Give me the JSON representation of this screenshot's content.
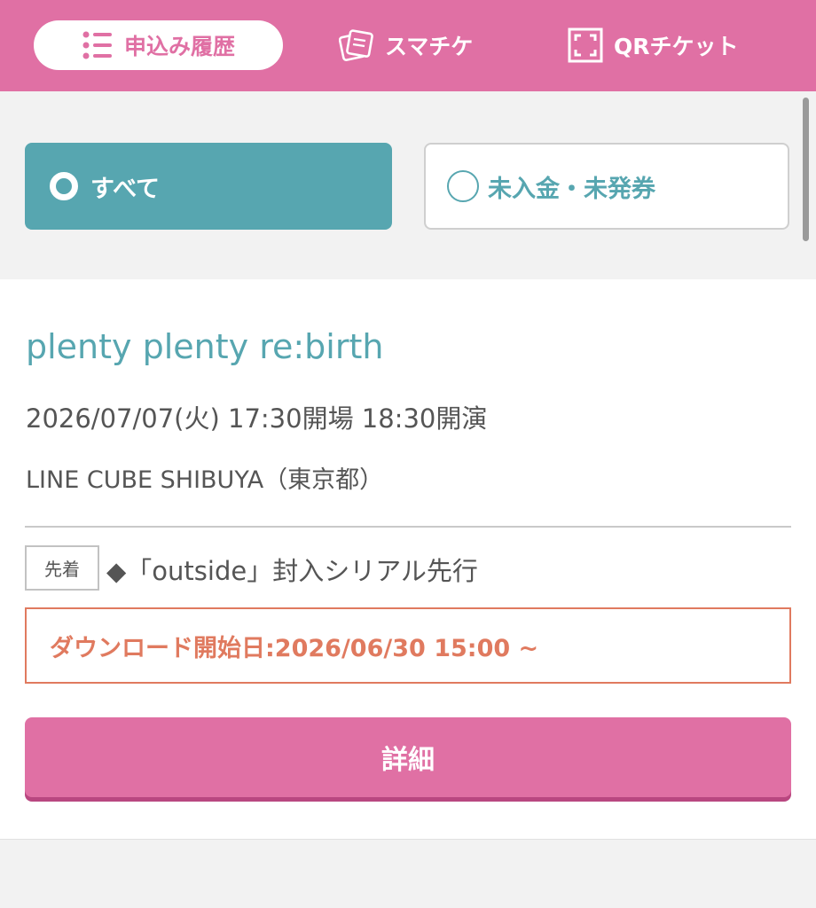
{
  "nav": {
    "tabs": [
      {
        "label": "申込み履歴",
        "icon": "list-icon",
        "active": true
      },
      {
        "label": "スマチケ",
        "icon": "ticket-icon",
        "active": false
      },
      {
        "label": "QRチケット",
        "icon": "qr-frame-icon",
        "active": false
      }
    ]
  },
  "filters": {
    "all": {
      "label": "すべて",
      "selected": true
    },
    "unpaid": {
      "label": "未入金・未発券",
      "selected": false
    }
  },
  "event": {
    "title": "plenty plenty re:birth",
    "datetime": "2026/07/07(火) 17:30開場 18:30開演",
    "venue": "LINE CUBE SHIBUYA（東京都）",
    "badge": "先着",
    "sale_type": "◆「outside」封入シリアル先行",
    "download_start": "ダウンロード開始日:2026/06/30 15:00 ~",
    "detail_label": "詳細"
  },
  "colors": {
    "brand_pink": "#e070a4",
    "teal": "#57a6b0",
    "download_orange": "#e07a5f",
    "text_gray": "#555555",
    "background": "#f2f2f2"
  }
}
